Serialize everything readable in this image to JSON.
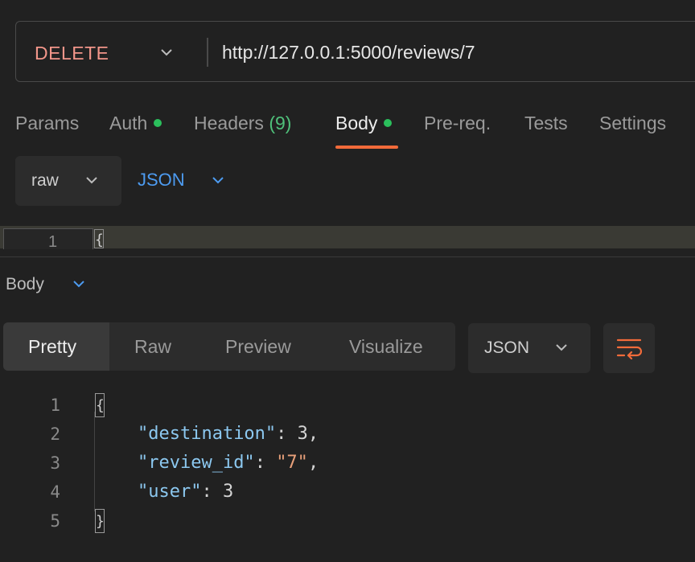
{
  "request": {
    "method": "DELETE",
    "url": "http://127.0.0.1:5000/reviews/7"
  },
  "request_tabs": [
    {
      "label": "Params"
    },
    {
      "label": "Auth",
      "dot": true
    },
    {
      "label": "Headers",
      "count": "(9)"
    },
    {
      "label": "Body",
      "dot": true,
      "active": true
    },
    {
      "label": "Pre-req."
    },
    {
      "label": "Tests"
    },
    {
      "label": "Settings"
    }
  ],
  "body_options": {
    "mode": "raw",
    "language": "JSON"
  },
  "request_editor": {
    "line_number": "1",
    "text": "{"
  },
  "response": {
    "section_label": "Body",
    "views": [
      "Pretty",
      "Raw",
      "Preview",
      "Visualize"
    ],
    "active_view": "Pretty",
    "format": "JSON",
    "lines": [
      {
        "n": "1",
        "open": "{"
      },
      {
        "n": "2",
        "key": "\"destination\"",
        "value": "3",
        "value_type": "number",
        "comma": ","
      },
      {
        "n": "3",
        "key": "\"review_id\"",
        "value": "\"7\"",
        "value_type": "string",
        "comma": ","
      },
      {
        "n": "4",
        "key": "\"user\"",
        "value": "3",
        "value_type": "number",
        "comma": ""
      },
      {
        "n": "5",
        "close": "}"
      }
    ]
  },
  "colors": {
    "method": "#f2968a",
    "accent_underline": "#f26b3a",
    "status_dot": "#2bbf5c",
    "json_link": "#4d9bf0",
    "json_key": "#8cc8f0",
    "json_string": "#e8a07a"
  },
  "icons": {
    "chevron": "chevron-down-icon",
    "wrap": "text-wrap-icon"
  }
}
